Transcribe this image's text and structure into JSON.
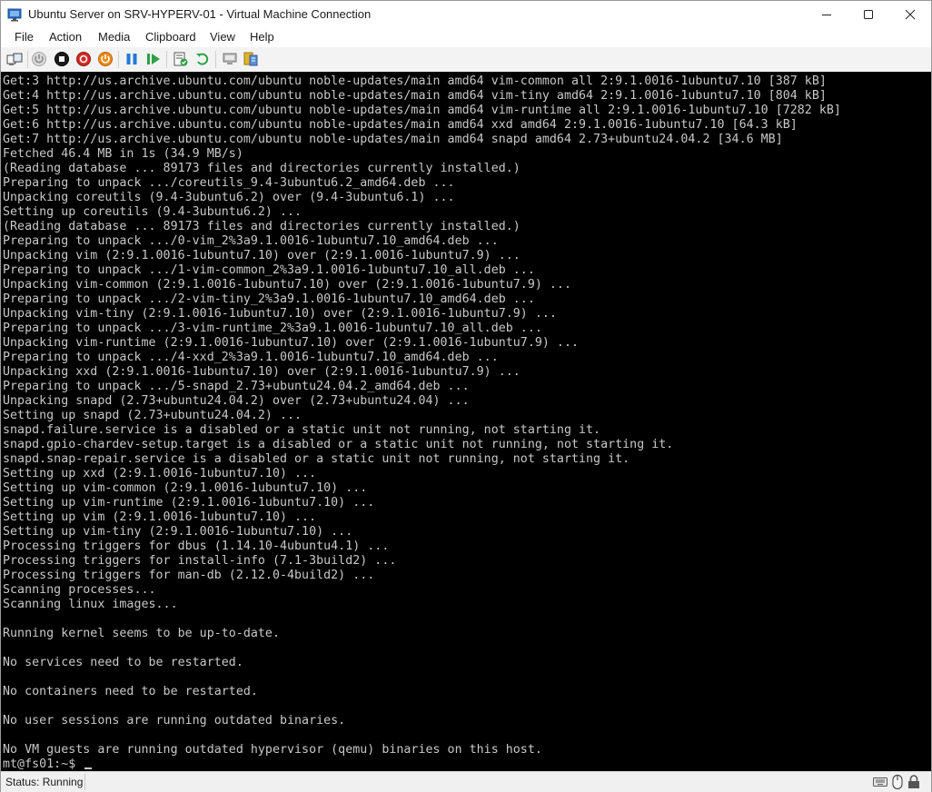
{
  "window": {
    "title": "Ubuntu Server on SRV-HYPERV-01 - Virtual Machine Connection",
    "app_icon": "vm-connection-icon"
  },
  "menu": [
    "File",
    "Action",
    "Media",
    "Clipboard",
    "View",
    "Help"
  ],
  "toolbar": {
    "buttons": [
      "ctrl-alt-del-icon",
      "start-icon",
      "turn-off-icon",
      "shut-down-icon",
      "save-state-icon",
      "pause-icon",
      "resume-icon",
      "checkpoint-icon",
      "revert-icon",
      "enhanced-session-icon",
      "share-icon"
    ]
  },
  "console": {
    "lines": [
      "Get:3 http://us.archive.ubuntu.com/ubuntu noble-updates/main amd64 vim-common all 2:9.1.0016-1ubuntu7.10 [387 kB]",
      "Get:4 http://us.archive.ubuntu.com/ubuntu noble-updates/main amd64 vim-tiny amd64 2:9.1.0016-1ubuntu7.10 [804 kB]",
      "Get:5 http://us.archive.ubuntu.com/ubuntu noble-updates/main amd64 vim-runtime all 2:9.1.0016-1ubuntu7.10 [7282 kB]",
      "Get:6 http://us.archive.ubuntu.com/ubuntu noble-updates/main amd64 xxd amd64 2:9.1.0016-1ubuntu7.10 [64.3 kB]",
      "Get:7 http://us.archive.ubuntu.com/ubuntu noble-updates/main amd64 snapd amd64 2.73+ubuntu24.04.2 [34.6 MB]",
      "Fetched 46.4 MB in 1s (34.9 MB/s)",
      "(Reading database ... 89173 files and directories currently installed.)",
      "Preparing to unpack .../coreutils_9.4-3ubuntu6.2_amd64.deb ...",
      "Unpacking coreutils (9.4-3ubuntu6.2) over (9.4-3ubuntu6.1) ...",
      "Setting up coreutils (9.4-3ubuntu6.2) ...",
      "(Reading database ... 89173 files and directories currently installed.)",
      "Preparing to unpack .../0-vim_2%3a9.1.0016-1ubuntu7.10_amd64.deb ...",
      "Unpacking vim (2:9.1.0016-1ubuntu7.10) over (2:9.1.0016-1ubuntu7.9) ...",
      "Preparing to unpack .../1-vim-common_2%3a9.1.0016-1ubuntu7.10_all.deb ...",
      "Unpacking vim-common (2:9.1.0016-1ubuntu7.10) over (2:9.1.0016-1ubuntu7.9) ...",
      "Preparing to unpack .../2-vim-tiny_2%3a9.1.0016-1ubuntu7.10_amd64.deb ...",
      "Unpacking vim-tiny (2:9.1.0016-1ubuntu7.10) over (2:9.1.0016-1ubuntu7.9) ...",
      "Preparing to unpack .../3-vim-runtime_2%3a9.1.0016-1ubuntu7.10_all.deb ...",
      "Unpacking vim-runtime (2:9.1.0016-1ubuntu7.10) over (2:9.1.0016-1ubuntu7.9) ...",
      "Preparing to unpack .../4-xxd_2%3a9.1.0016-1ubuntu7.10_amd64.deb ...",
      "Unpacking xxd (2:9.1.0016-1ubuntu7.10) over (2:9.1.0016-1ubuntu7.9) ...",
      "Preparing to unpack .../5-snapd_2.73+ubuntu24.04.2_amd64.deb ...",
      "Unpacking snapd (2.73+ubuntu24.04.2) over (2.73+ubuntu24.04) ...",
      "Setting up snapd (2.73+ubuntu24.04.2) ...",
      "snapd.failure.service is a disabled or a static unit not running, not starting it.",
      "snapd.gpio-chardev-setup.target is a disabled or a static unit not running, not starting it.",
      "snapd.snap-repair.service is a disabled or a static unit not running, not starting it.",
      "Setting up xxd (2:9.1.0016-1ubuntu7.10) ...",
      "Setting up vim-common (2:9.1.0016-1ubuntu7.10) ...",
      "Setting up vim-runtime (2:9.1.0016-1ubuntu7.10) ...",
      "Setting up vim (2:9.1.0016-1ubuntu7.10) ...",
      "Setting up vim-tiny (2:9.1.0016-1ubuntu7.10) ...",
      "Processing triggers for dbus (1.14.10-4ubuntu4.1) ...",
      "Processing triggers for install-info (7.1-3build2) ...",
      "Processing triggers for man-db (2.12.0-4build2) ...",
      "Scanning processes...",
      "Scanning linux images...",
      "",
      "Running kernel seems to be up-to-date.",
      "",
      "No services need to be restarted.",
      "",
      "No containers need to be restarted.",
      "",
      "No user sessions are running outdated binaries.",
      "",
      "No VM guests are running outdated hypervisor (qemu) binaries on this host."
    ],
    "prompt": "mt@fs01:~$"
  },
  "status": {
    "text": "Status: Running"
  }
}
